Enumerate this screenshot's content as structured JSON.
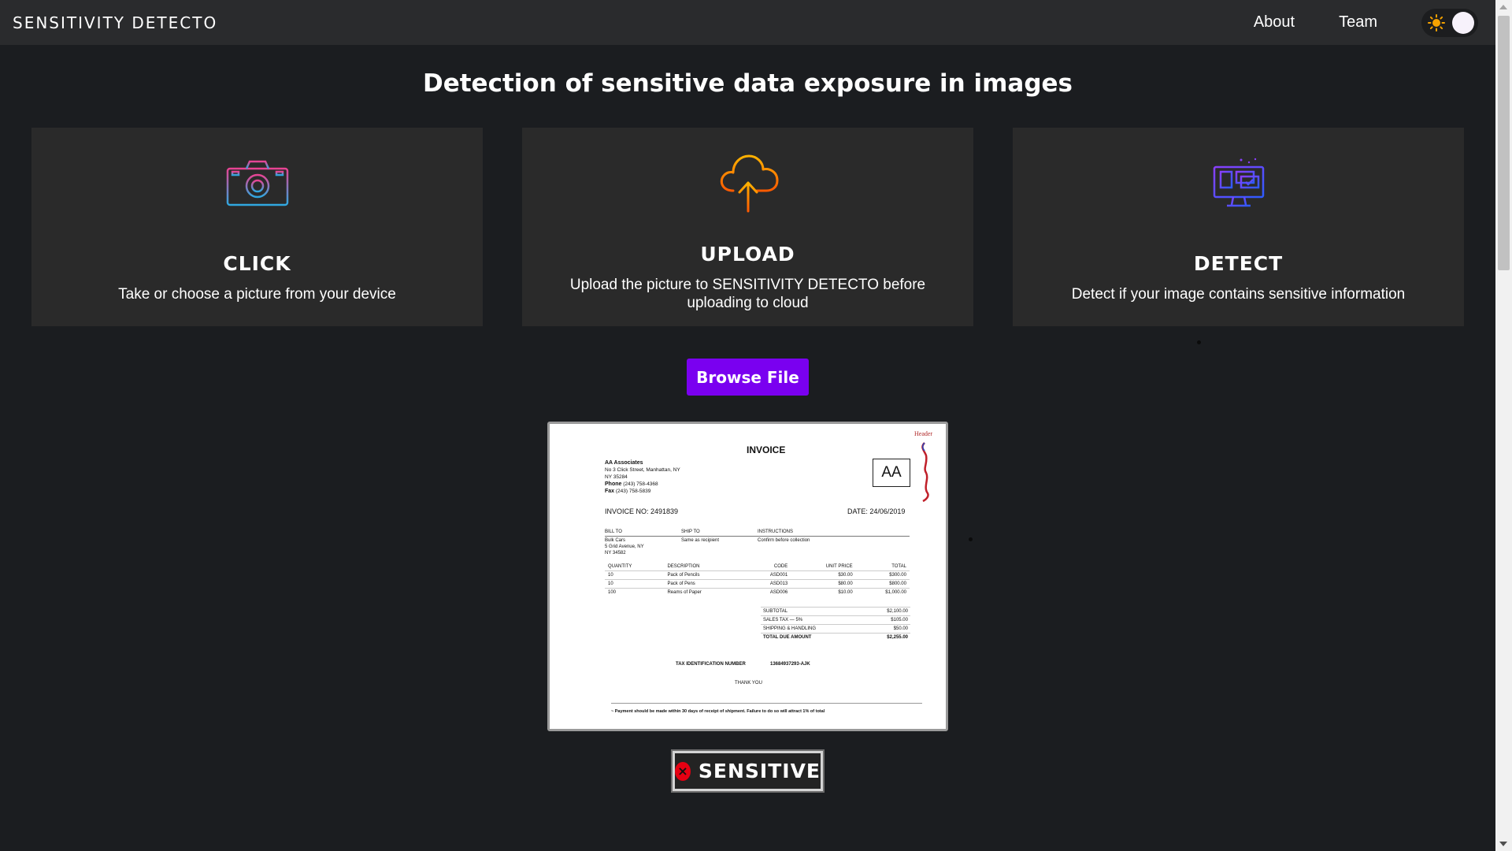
{
  "app": {
    "brand": "SENSITIVITY DETECTO"
  },
  "nav": {
    "links": [
      "About",
      "Team"
    ],
    "theme_toggle_icon": "sun-icon"
  },
  "main": {
    "title": "Detection of sensitive data exposure in images",
    "cards": [
      {
        "icon": "camera-icon",
        "title": "CLICK",
        "description": "Take or choose a picture from your device"
      },
      {
        "icon": "cloud-upload-icon",
        "title": "UPLOAD",
        "description": "Upload the picture to SENSITIVITY DETECTO before uploading to cloud"
      },
      {
        "icon": "monitor-detect-icon",
        "title": "DETECT",
        "description": "Detect if your image contains sensitive information"
      }
    ],
    "browse_button": "Browse File",
    "result": {
      "status": "SENSITIVE",
      "icon": "error-x-icon",
      "color": "#e60012"
    }
  },
  "invoice_preview": {
    "header_note": "Header",
    "title": "INVOICE",
    "logo_text": "AA",
    "company_name": "AA Associates",
    "company_address_1": "No 3 Click Street, Manhattan, NY",
    "company_address_2": "NY 35284",
    "phone_label": "Phone",
    "phone": "(243) 758-4368",
    "fax_label": "Fax",
    "fax": "(243) 758-5839",
    "invoice_no": "INVOICE NO: 2491839",
    "date": "DATE: 24/06/2019",
    "bill_to_header": "BILL TO",
    "ship_to_header": "SHIP TO",
    "instructions_header": "INSTRUCTIONS",
    "bill_to_1": "Bulk Cars",
    "bill_to_2": "5 Grid Avenue, NY",
    "bill_to_3": "NY 34582",
    "ship_to": "Same as recipient",
    "instructions": "Confirm before collection",
    "columns": [
      "QUANTITY",
      "DESCRIPTION",
      "CODE",
      "UNIT PRICE",
      "TOTAL"
    ],
    "rows": [
      [
        "10",
        "Pack of Pencils",
        "ASD001",
        "$30.00",
        "$300.00"
      ],
      [
        "10",
        "Pack of Pens",
        "ASD013",
        "$80.00",
        "$800.00"
      ],
      [
        "100",
        "Reams of Paper",
        "ASD006",
        "$10.00",
        "$1,000.00"
      ]
    ],
    "totals": [
      [
        "SUBTOTAL",
        "$2,100.00"
      ],
      [
        "SALES TAX — 5%",
        "$105.00"
      ],
      [
        "SHIPPING & HANDLING",
        "$50.00"
      ],
      [
        "TOTAL DUE AMOUNT",
        "$2,255.00"
      ]
    ],
    "tax_id_label": "TAX IDENTIFICATION NUMBER",
    "tax_id_value": "13684937293-AJK",
    "thanks": "THANK YOU",
    "payment_note": "~ Payment should be made within 30 days of receipt of shipment. Failure to do so will attract 1% of total"
  }
}
